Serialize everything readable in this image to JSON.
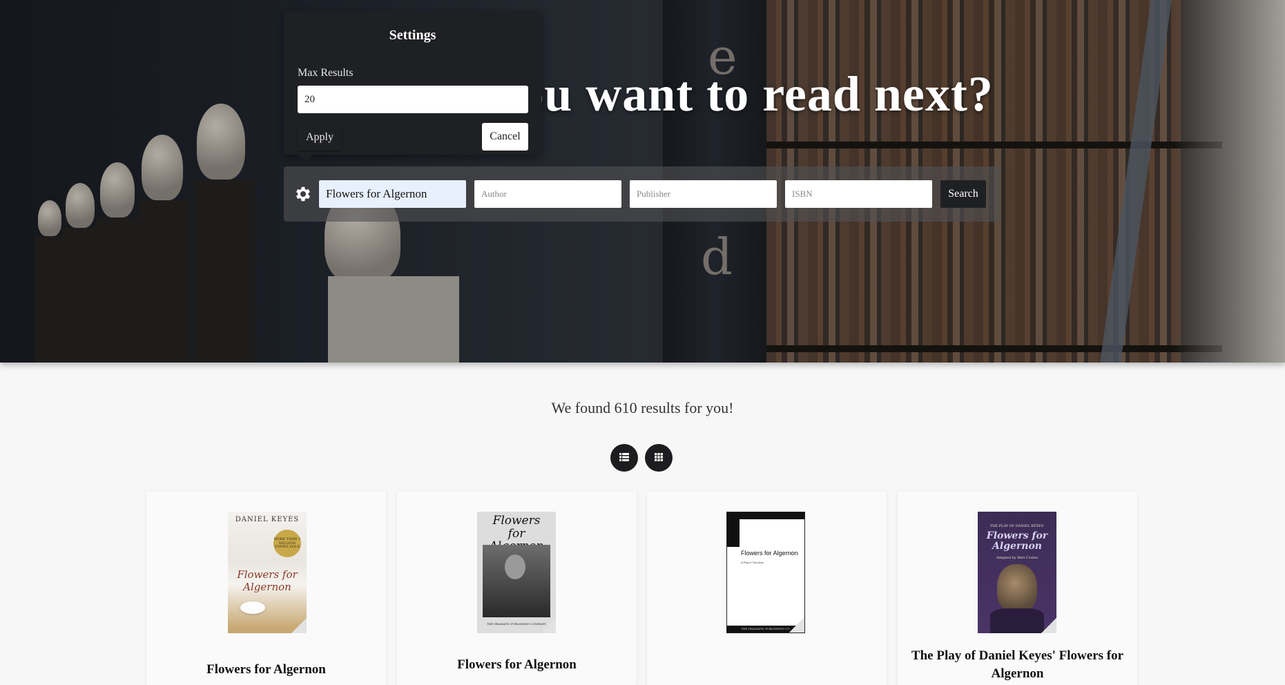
{
  "hero": {
    "headline": "What do you want to read next?"
  },
  "settings": {
    "title": "Settings",
    "max_results_label": "Max Results",
    "max_results_value": "20",
    "apply_label": "Apply",
    "cancel_label": "Cancel"
  },
  "search": {
    "title_value": "Flowers for Algernon",
    "author_placeholder": "Author",
    "publisher_placeholder": "Publisher",
    "isbn_placeholder": "ISBN",
    "search_label": "Search",
    "settings_icon": "gear-icon"
  },
  "results": {
    "summary": "We found 610 results for you!",
    "view_buttons": [
      {
        "icon": "list-view-icon"
      },
      {
        "icon": "grid-view-icon"
      }
    ]
  },
  "books": [
    {
      "title": "Flowers for Algernon",
      "cover_author": "DANIEL KEYES",
      "cover_badge": "MORE THAN 5 MILLION COPIES SOLD",
      "cover_title": "Flowers for Algernon"
    },
    {
      "title": "Flowers for Algernon",
      "cover_title": "Flowers for Algernon",
      "cover_footer": "THE DRAMATIC PUBLISHING COMPANY"
    },
    {
      "title": "",
      "cover_title": "Flowers for Algernon",
      "cover_sub": "A Play in Two Acts",
      "cover_footer": "THE DRAMATIC PUBLISHING CO."
    },
    {
      "title": "The Play of Daniel Keyes' Flowers for Algernon",
      "cover_top": "THE PLAY OF DANIEL KEYES'",
      "cover_title": "Flowers for Algernon",
      "cover_sub": "Adapted by Bert Coules"
    }
  ]
}
